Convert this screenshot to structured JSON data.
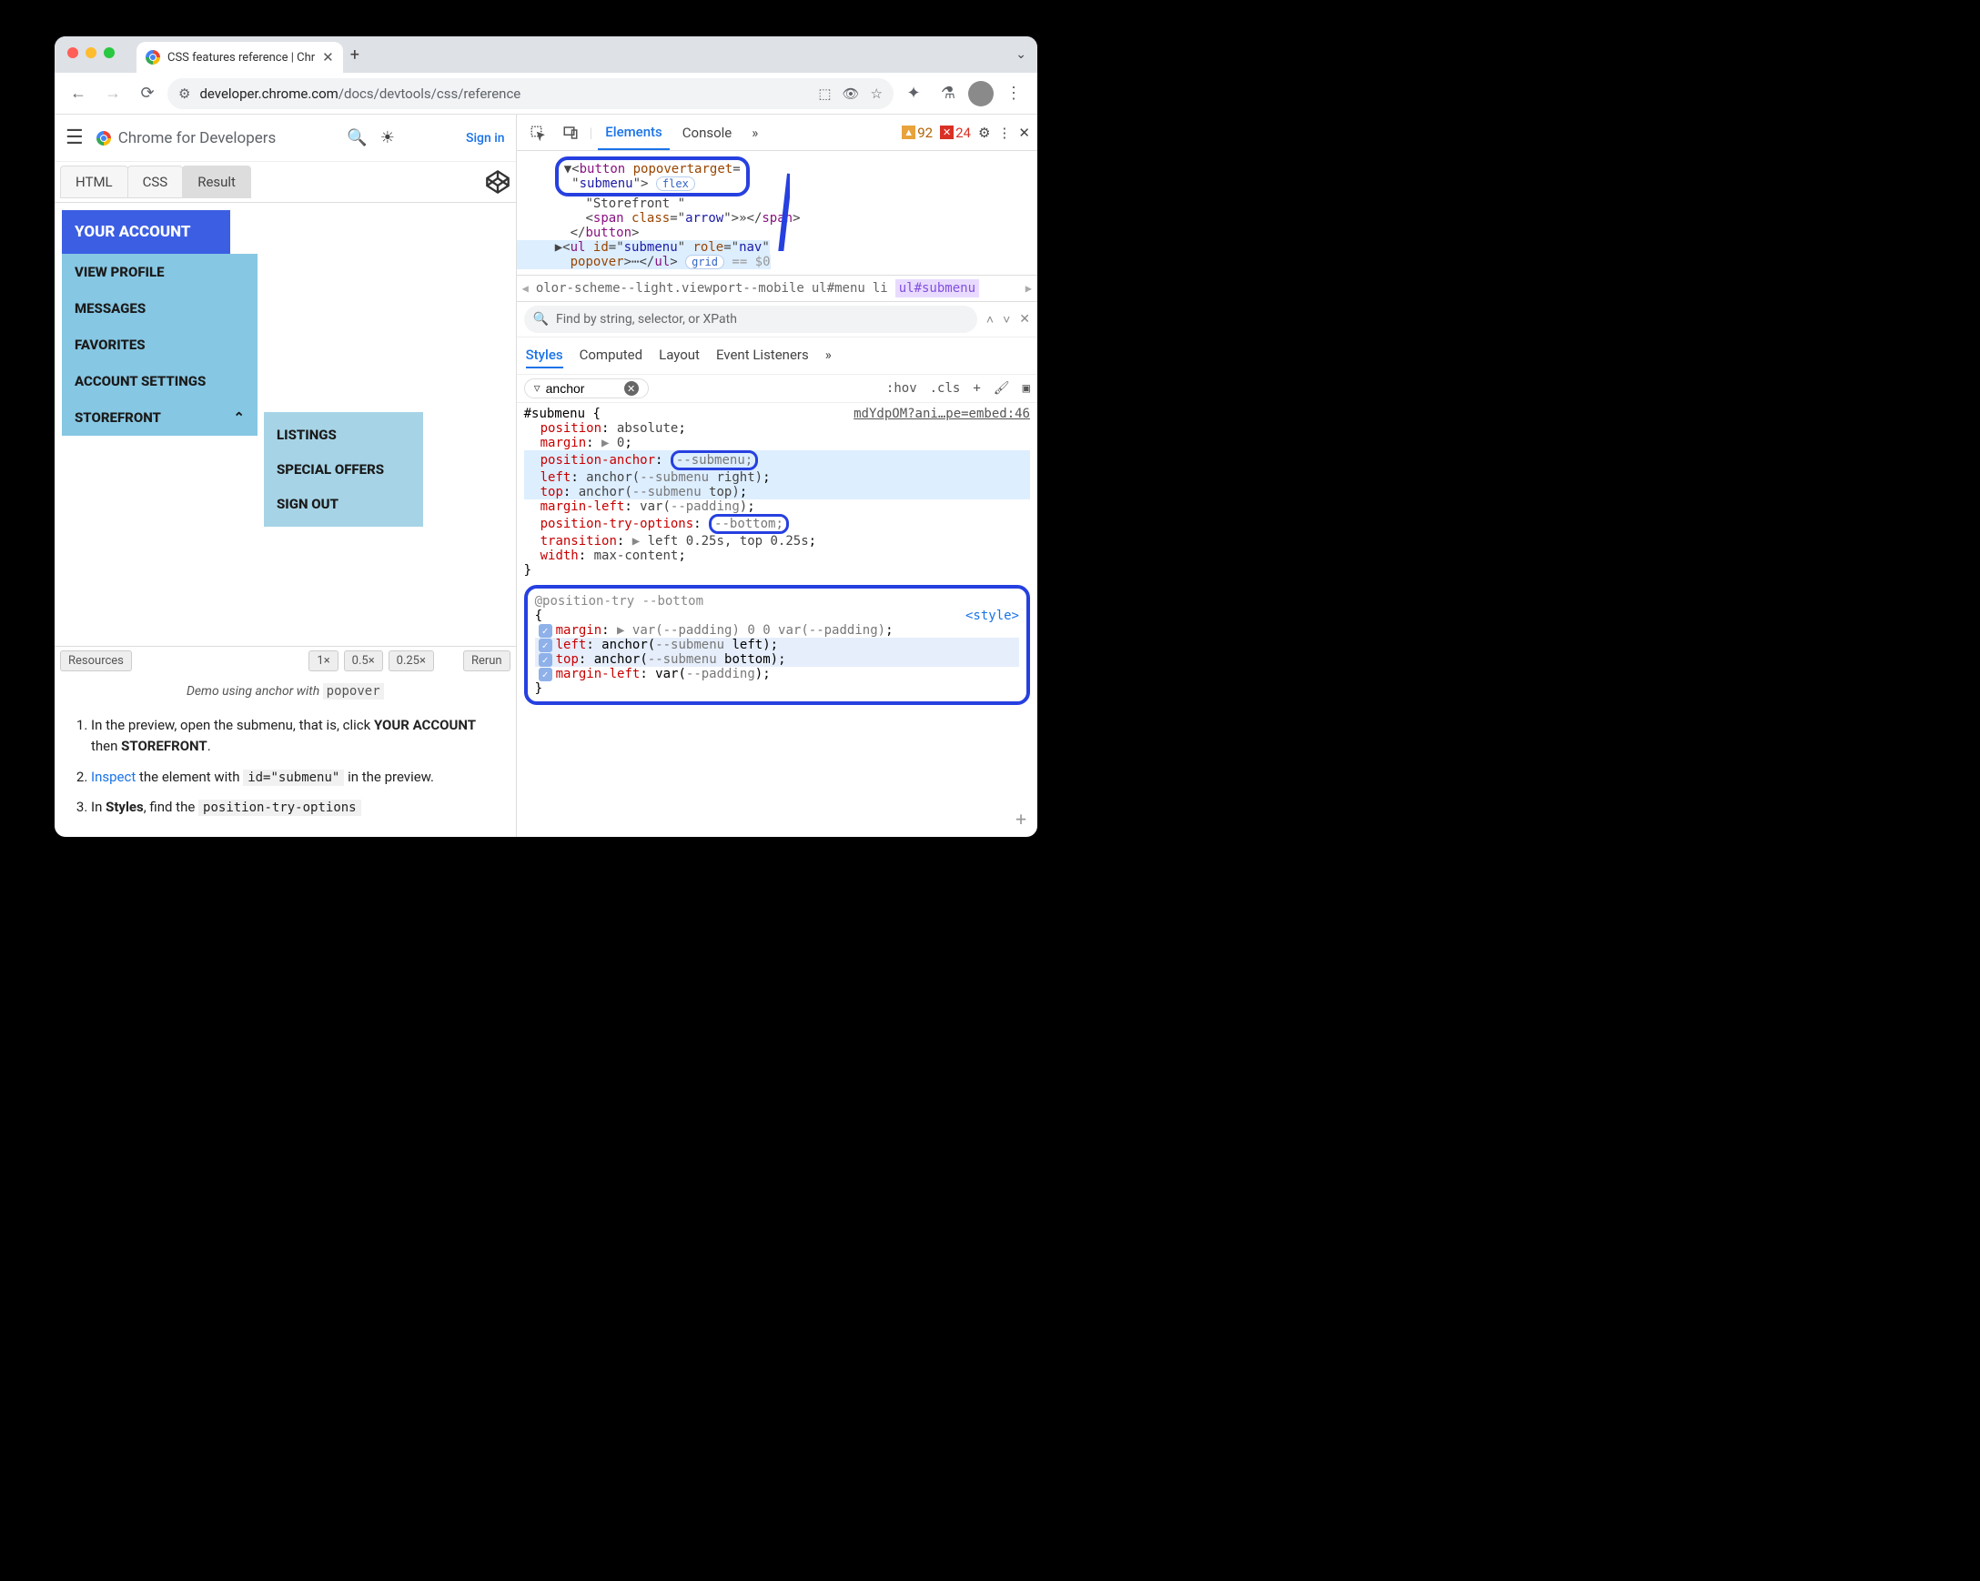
{
  "browser": {
    "tab_title": "CSS features reference  |  Chr",
    "url_host": "developer.chrome.com",
    "url_path": "/docs/devtools/css/reference"
  },
  "site": {
    "brand": "Chrome for Developers",
    "signin": "Sign in"
  },
  "editor_tabs": {
    "html": "HTML",
    "css": "CSS",
    "result": "Result"
  },
  "menu": {
    "header": "YOUR ACCOUNT",
    "items": [
      "VIEW PROFILE",
      "MESSAGES",
      "FAVORITES",
      "ACCOUNT SETTINGS",
      "STOREFRONT"
    ],
    "submenu": [
      "LISTINGS",
      "SPECIAL OFFERS",
      "SIGN OUT"
    ]
  },
  "preview_footer": {
    "resources": "Resources",
    "z1": "1×",
    "z05": "0.5×",
    "z025": "0.25×",
    "rerun": "Rerun"
  },
  "caption_pre": "Demo using anchor with ",
  "caption_code": "popover",
  "steps": {
    "s1a": "In the preview, open the submenu, that is, click ",
    "s1b": "YOUR ACCOUNT",
    "s1c": " then ",
    "s1d": "STOREFRONT",
    "s2a": "Inspect",
    "s2b": " the element with ",
    "s2c": "id=\"submenu\"",
    "s2d": " in the preview.",
    "s3a": "In ",
    "s3b": "Styles",
    "s3c": ", find the ",
    "s3d": "position-try-options"
  },
  "devtools": {
    "tabs": {
      "elements": "Elements",
      "console": "Console"
    },
    "warn_count": "92",
    "err_count": "24",
    "dom": {
      "l1a": "button",
      "l1b": "popovertarget",
      "l1c": "submenu",
      "l1pill": "flex",
      "l2": "\"Storefront \"",
      "l3a": "span",
      "l3b": "class",
      "l3c": "arrow",
      "l3d": "»",
      "l4": "button",
      "l5a": "ul",
      "l5b": "id",
      "l5c": "submenu",
      "l5d": "role",
      "l5e": "nav",
      "l6a": "popover",
      "l6pill": "grid",
      "l6dim": " == $0"
    },
    "breadcrumb": {
      "seg1": "olor-scheme--light.viewport--mobile",
      "seg2": "ul#menu",
      "seg3": "li",
      "seg4": "ul#submenu"
    },
    "search_placeholder": "Find by string, selector, or XPath",
    "subtabs": {
      "styles": "Styles",
      "computed": "Computed",
      "layout": "Layout",
      "listeners": "Event Listeners"
    },
    "filter_value": "anchor",
    "hov": ":hov",
    "cls": ".cls",
    "rule": {
      "selector": "#submenu {",
      "source": "mdYdpOM?ani…pe=embed:46",
      "p1n": "position",
      "p1v": "absolute",
      "p2n": "margin",
      "p2v": "0",
      "p3n": "position-anchor",
      "p3v": "--submenu",
      "p4n": "left",
      "p4v_a": "anchor(",
      "p4v_b": "--submenu",
      "p4v_c": " right)",
      "p5n": "top",
      "p5v_a": "anchor(",
      "p5v_b": "--submenu",
      "p5v_c": " top)",
      "p6n": "margin-left",
      "p6v_a": "var(",
      "p6v_b": "--padding",
      "p6v_c": ")",
      "p7n": "position-try-options",
      "p7v": "--bottom",
      "p8n": "transition",
      "p8v": "left 0.25s, top 0.25s",
      "p9n": "width",
      "p9v": "max-content",
      "close": "}"
    },
    "block2": {
      "head": "@position-try --bottom",
      "style": "<style>",
      "r1n": "margin",
      "r1v": "var(--padding) 0 0 var(--padding)",
      "r2n": "left",
      "r2v_a": "anchor(",
      "r2v_b": "--submenu",
      "r2v_c": " left)",
      "r3n": "top",
      "r3v_a": "anchor(",
      "r3v_b": "--submenu",
      "r3v_c": " bottom)",
      "r4n": "margin-left",
      "r4v_a": "var(",
      "r4v_b": "--padding",
      "r4v_c": ")"
    }
  }
}
